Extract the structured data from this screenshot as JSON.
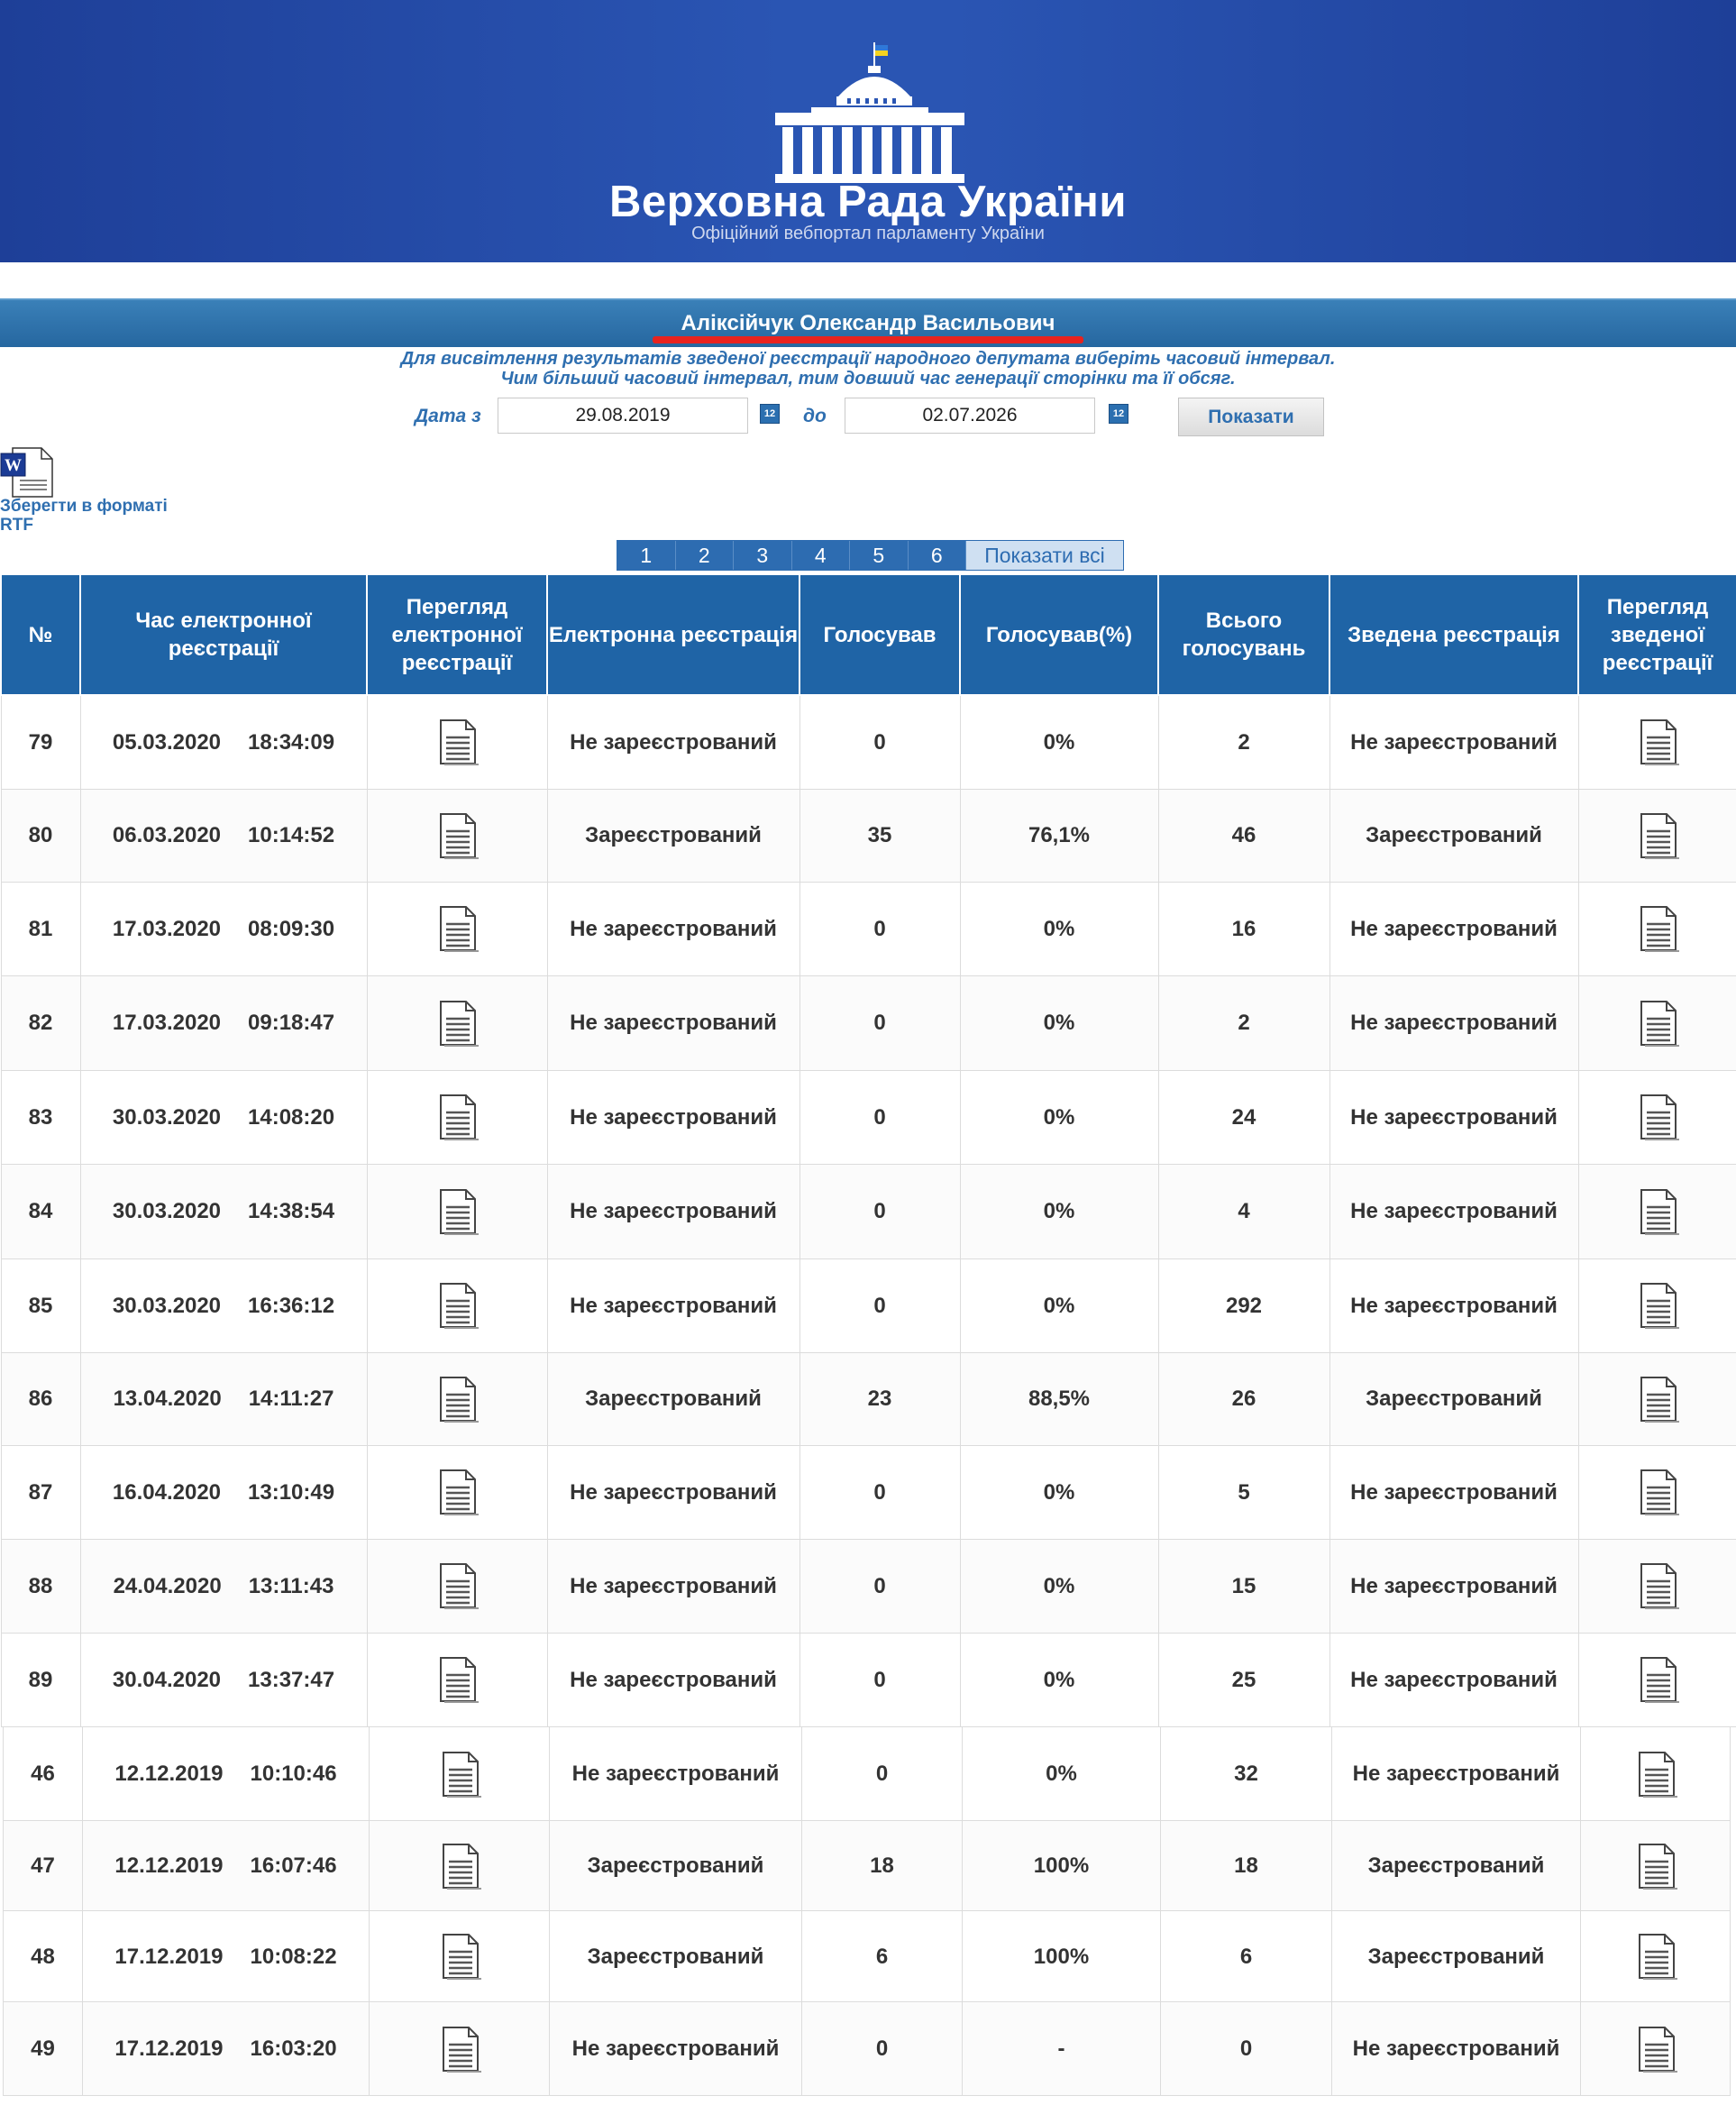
{
  "header": {
    "site_title": "Верховна Рада України",
    "site_subtitle": "Офіційний вебпортал парламенту України"
  },
  "deputy": {
    "name": "Аліксійчук Олександр Васильович"
  },
  "instructions": {
    "line1": "Для висвітлення результатів зведеної реєстрації народного депутата виберіть часовий інтервал.",
    "line2": "Чим більший часовий інтервал, тим довший час генерації сторінки та її обсяг."
  },
  "form": {
    "date_from_label": "Дата з",
    "date_from_value": "29.08.2019",
    "date_to_label": "до",
    "date_to_value": "02.07.2026",
    "show_button": "Показати",
    "calendar_icon": "calendar-icon"
  },
  "export": {
    "label": "Зберегти в форматі RTF",
    "icon": "word-document-icon"
  },
  "pagination": {
    "pages": [
      "1",
      "2",
      "3",
      "4",
      "5",
      "6"
    ],
    "show_all": "Показати всі"
  },
  "table": {
    "headers": [
      "№",
      "Час електронної реєстрації",
      "Перегляд електронної реєстрації",
      "Електронна реєстрація",
      "Голосував",
      "Голосував(%)",
      "Всього голосувань",
      "Зведена реєстрація",
      "Перегляд зведеної реєстрації"
    ],
    "row_icon": "document-icon",
    "status_colors": {
      "not_registered": "#e51c1c",
      "registered": "#118a1a"
    },
    "rows_a": [
      {
        "n": "79",
        "date": "05.03.2020",
        "time": "18:34:09",
        "e_reg": "Не зареєстрований",
        "voted": "0",
        "pct": "0%",
        "total": "2",
        "summary": "Не зареєстрований",
        "reg": false
      },
      {
        "n": "80",
        "date": "06.03.2020",
        "time": "10:14:52",
        "e_reg": "Зареєстрований",
        "voted": "35",
        "pct": "76,1%",
        "total": "46",
        "summary": "Зареєстрований",
        "reg": true
      },
      {
        "n": "81",
        "date": "17.03.2020",
        "time": "08:09:30",
        "e_reg": "Не зареєстрований",
        "voted": "0",
        "pct": "0%",
        "total": "16",
        "summary": "Не зареєстрований",
        "reg": false
      },
      {
        "n": "82",
        "date": "17.03.2020",
        "time": "09:18:47",
        "e_reg": "Не зареєстрований",
        "voted": "0",
        "pct": "0%",
        "total": "2",
        "summary": "Не зареєстрований",
        "reg": false
      },
      {
        "n": "83",
        "date": "30.03.2020",
        "time": "14:08:20",
        "e_reg": "Не зареєстрований",
        "voted": "0",
        "pct": "0%",
        "total": "24",
        "summary": "Не зареєстрований",
        "reg": false
      },
      {
        "n": "84",
        "date": "30.03.2020",
        "time": "14:38:54",
        "e_reg": "Не зареєстрований",
        "voted": "0",
        "pct": "0%",
        "total": "4",
        "summary": "Не зареєстрований",
        "reg": false
      },
      {
        "n": "85",
        "date": "30.03.2020",
        "time": "16:36:12",
        "e_reg": "Не зареєстрований",
        "voted": "0",
        "pct": "0%",
        "total": "292",
        "summary": "Не зареєстрований",
        "reg": false
      },
      {
        "n": "86",
        "date": "13.04.2020",
        "time": "14:11:27",
        "e_reg": "Зареєстрований",
        "voted": "23",
        "pct": "88,5%",
        "total": "26",
        "summary": "Зареєстрований",
        "reg": true
      },
      {
        "n": "87",
        "date": "16.04.2020",
        "time": "13:10:49",
        "e_reg": "Не зареєстрований",
        "voted": "0",
        "pct": "0%",
        "total": "5",
        "summary": "Не зареєстрований",
        "reg": false
      },
      {
        "n": "88",
        "date": "24.04.2020",
        "time": "13:11:43",
        "e_reg": "Не зареєстрований",
        "voted": "0",
        "pct": "0%",
        "total": "15",
        "summary": "Не зареєстрований",
        "reg": false
      },
      {
        "n": "89",
        "date": "30.04.2020",
        "time": "13:37:47",
        "e_reg": "Не зареєстрований",
        "voted": "0",
        "pct": "0%",
        "total": "25",
        "summary": "Не зареєстрований",
        "reg": false
      }
    ],
    "rows_b": [
      {
        "n": "46",
        "date": "12.12.2019",
        "time": "10:10:46",
        "e_reg": "Не зареєстрований",
        "voted": "0",
        "pct": "0%",
        "total": "32",
        "summary": "Не зареєстрований",
        "reg": false
      },
      {
        "n": "47",
        "date": "12.12.2019",
        "time": "16:07:46",
        "e_reg": "Зареєстрований",
        "voted": "18",
        "pct": "100%",
        "total": "18",
        "summary": "Зареєстрований",
        "reg": true
      },
      {
        "n": "48",
        "date": "17.12.2019",
        "time": "10:08:22",
        "e_reg": "Зареєстрований",
        "voted": "6",
        "pct": "100%",
        "total": "6",
        "summary": "Зареєстрований",
        "reg": true
      },
      {
        "n": "49",
        "date": "17.12.2019",
        "time": "16:03:20",
        "e_reg": "Не зареєстрований",
        "voted": "0",
        "pct": "-",
        "total": "0",
        "summary": "Не зареєстрований",
        "reg": false
      }
    ]
  }
}
